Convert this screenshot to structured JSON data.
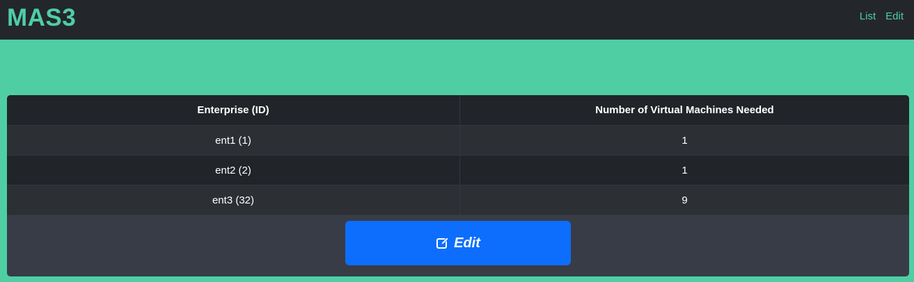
{
  "navbar": {
    "brand": "MAS3",
    "links": [
      {
        "label": "List"
      },
      {
        "label": "Edit"
      }
    ]
  },
  "table": {
    "headers": [
      "Enterprise (ID)",
      "Number of Virtual Machines Needed"
    ],
    "rows": [
      [
        "ent1 (1)",
        "1"
      ],
      [
        "ent2 (2)",
        "1"
      ],
      [
        "ent3 (32)",
        "9"
      ]
    ]
  },
  "edit_button": {
    "label": "Edit",
    "icon": "edit-icon"
  },
  "colors": {
    "accent": "#4fcea4",
    "navbar_bg": "#23272c",
    "button_bg": "#0d6efd"
  }
}
